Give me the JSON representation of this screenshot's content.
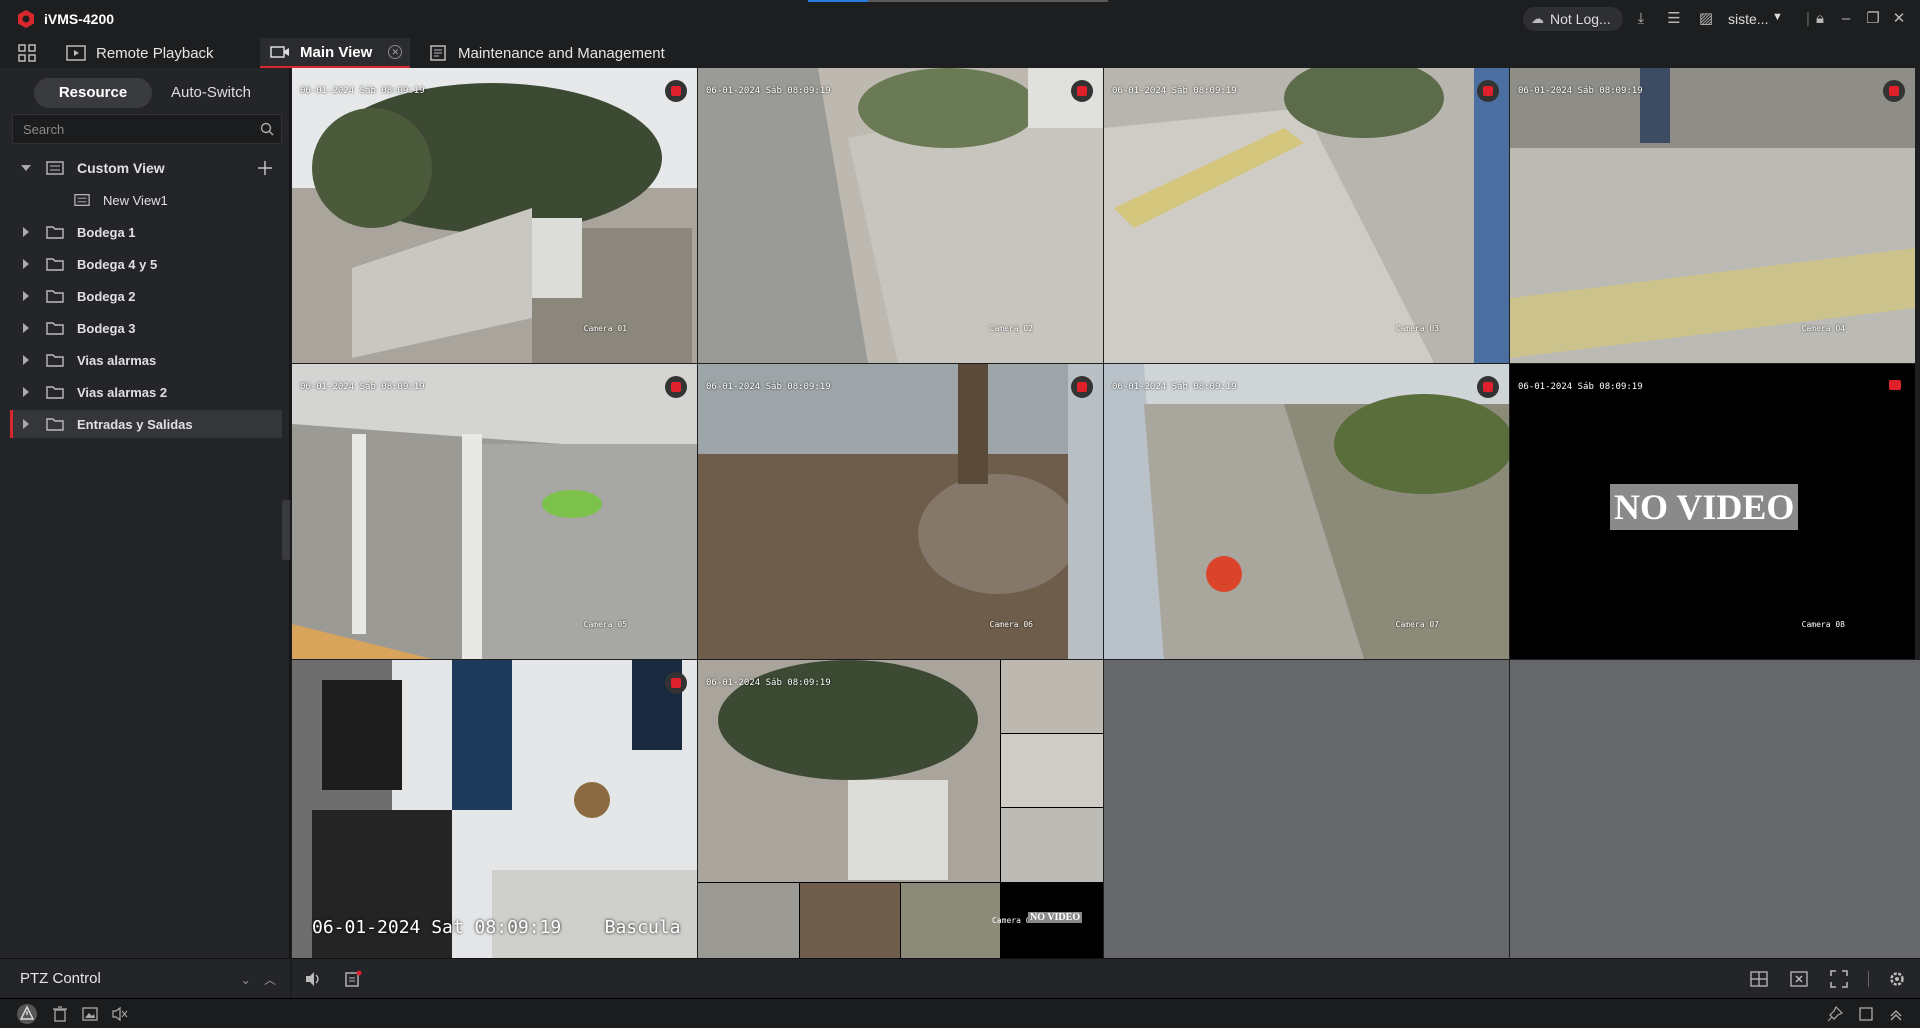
{
  "app": {
    "title": "iVMS-4200",
    "brand_color": "#d9272e"
  },
  "topbar": {
    "account": "Not Log...",
    "user": "siste..."
  },
  "tabs": {
    "remote_playback": "Remote Playback",
    "main_view": "Main View",
    "maintenance": "Maintenance and Management"
  },
  "sidebar": {
    "segments": {
      "resource": "Resource",
      "auto_switch": "Auto-Switch"
    },
    "search": {
      "placeholder": "Search"
    },
    "custom_view": "Custom View",
    "new_view": "New View1",
    "folders": [
      "Bodega 1",
      "Bodega 4 y 5",
      "Bodega 2",
      "Bodega 3",
      "Vias alarmas",
      "Vias alarmas 2",
      "Entradas y Salidas"
    ],
    "selected_folder": "Entradas y Salidas",
    "ptz": "PTZ Control"
  },
  "cameras": {
    "timestamp": "06-01-2024 Sáb 08:09:19",
    "c1": "Camera 01",
    "c2": "Camera 02",
    "c3": "Camera 03",
    "c4": "Camera 04",
    "c5": "Camera 05",
    "c6": "Camera 06",
    "c7": "Camera 07",
    "c8": "Camera 08",
    "no_video": "NO VIDEO",
    "bascula_time": "06-01-2024 Sat 08:09:19",
    "bascula": "Bascula",
    "mini_cam": "Camera 0",
    "mini_no_video": "NO VIDEO"
  },
  "icons": {
    "toolbar": [
      "volume-icon",
      "record-icon",
      "layout-icon",
      "close-all-icon",
      "fullscreen-icon",
      "settings-icon"
    ],
    "status": [
      "alarm-icon",
      "delete-icon",
      "picture-icon",
      "mute-icon",
      "pin-icon",
      "window-icon",
      "collapse-icon"
    ]
  }
}
